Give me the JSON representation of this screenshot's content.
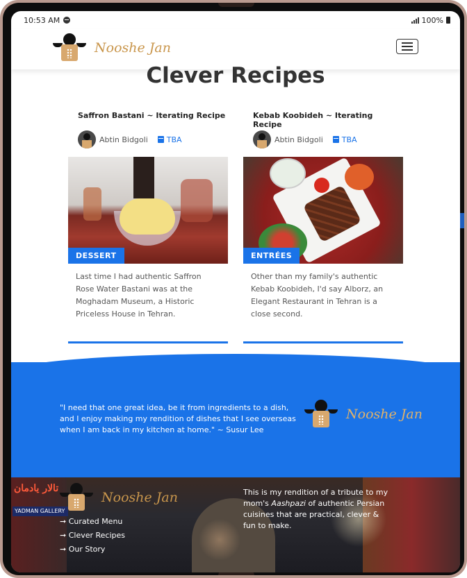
{
  "status_bar": {
    "time": "10:53 AM",
    "battery": "100%"
  },
  "header": {
    "brand": "Nooshe Jan",
    "menu_icon": "hamburger-menu-icon"
  },
  "page": {
    "title": "Clever Recipes"
  },
  "cards": [
    {
      "title": "Saffron Bastani ~ Iterating Recipe",
      "author": "Abtin Bidgoli",
      "date": "TBA",
      "category": "DESSERT",
      "excerpt": "Last time I had authentic Saffron Rose Water Bastani was at the Moghadam Museum, a Historic Priceless House in Tehran."
    },
    {
      "title": "Kebab Koobideh ~ Iterating Recipe",
      "author": "Abtin Bidgoli",
      "date": "TBA",
      "category": "ENTRÉES",
      "excerpt": "Other than my family's authentic Kebab Koobideh, I'd say Alborz, an Elegant Restaurant in Tehran is a close second."
    }
  ],
  "quote": {
    "text": "\"I need that one great idea, be it from ingredients to a dish, and I enjoy making my rendition of dishes that I see overseas when I am back in my kitchen at home.\" ~ Susur Lee",
    "brand": "Nooshe Jan"
  },
  "footer": {
    "brand": "Nooshe Jan",
    "sign_text": "تالار یادمان",
    "gallery_text": "YADMAN GALLERY",
    "links": [
      "➞ Curated Menu",
      "➞ Clever Recipes",
      "➞ Our Story"
    ],
    "about_prefix": "This is my rendition of a tribute to my mom's ",
    "about_em": "Aashpazi",
    "about_suffix": " of authentic Persian cuisines that are practical, clever & fun to make."
  },
  "colors": {
    "accent": "#1a73e8",
    "brand_gold": "#c9964c",
    "title": "#333333",
    "text": "#555555"
  }
}
